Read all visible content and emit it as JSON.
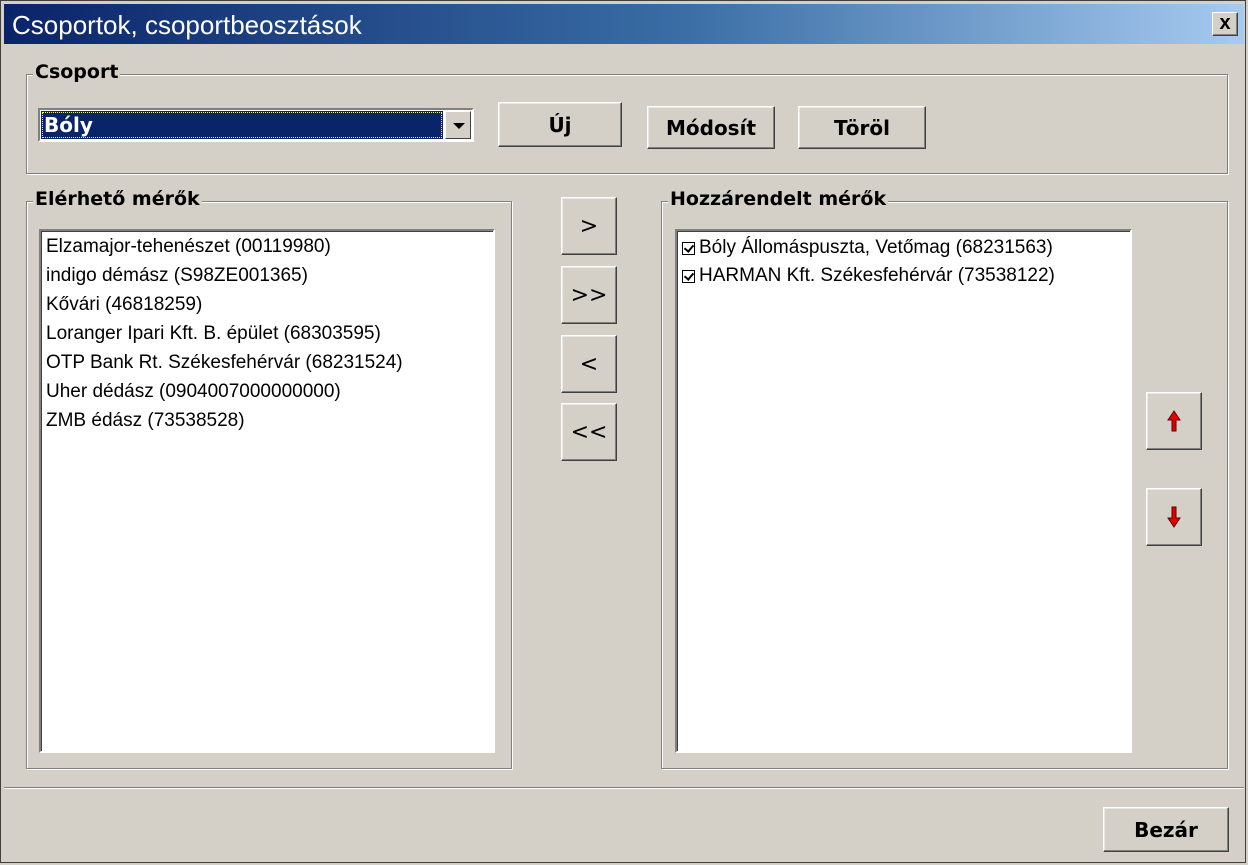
{
  "window": {
    "title": "Csoportok, csoportbeosztások",
    "close_label": "x"
  },
  "group_box": {
    "legend": "Csoport",
    "selected": "Bóly",
    "new_label": "Új",
    "edit_label": "Módosít",
    "delete_label": "Töröl"
  },
  "available": {
    "legend": "Elérhető mérők",
    "items": [
      "Elzamajor-tehenészet (00119980)",
      "indigo démász (S98ZE001365)",
      "Kővári (46818259)",
      "Loranger Ipari Kft. B. épület (68303595)",
      "OTP Bank Rt. Székesfehérvár (68231524)",
      "Uher dédász (0904007000000000)",
      "ZMB édász (73538528)"
    ]
  },
  "transfer": {
    "add": ">",
    "add_all": ">>",
    "remove": "<",
    "remove_all": "<<"
  },
  "assigned": {
    "legend": "Hozzárendelt mérők",
    "items": [
      {
        "label": "Bóly Állomáspuszta, Vetőmag (68231563)",
        "checked": true
      },
      {
        "label": "HARMAN Kft. Székesfehérvár (73538122)",
        "checked": true
      }
    ]
  },
  "order": {
    "up_icon": "arrow-up-icon",
    "down_icon": "arrow-down-icon",
    "arrow_color": "#e00000"
  },
  "footer": {
    "close_label": "Bezár"
  }
}
